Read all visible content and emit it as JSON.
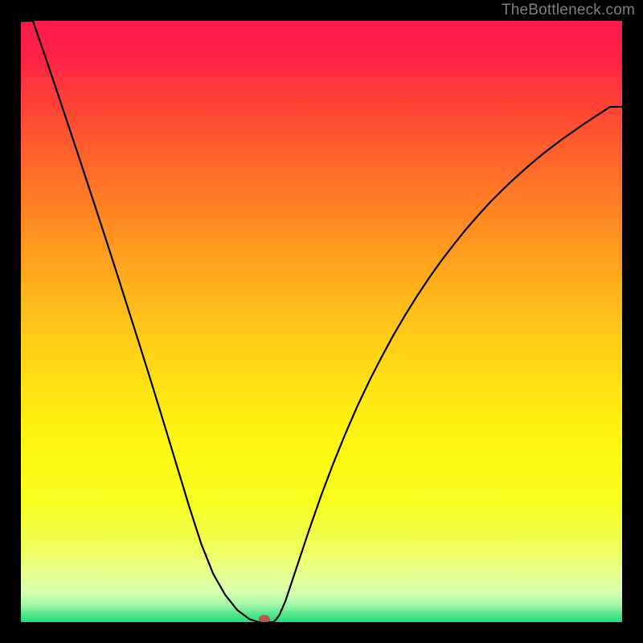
{
  "watermark": "TheBottleneck.com",
  "chart_data": {
    "type": "line",
    "x": [
      0.0,
      0.02,
      0.04,
      0.06,
      0.08,
      0.1,
      0.12,
      0.14,
      0.16,
      0.18,
      0.2,
      0.22,
      0.24,
      0.26,
      0.28,
      0.3,
      0.32,
      0.34,
      0.36,
      0.38,
      0.395,
      0.4,
      0.405,
      0.41,
      0.415,
      0.42,
      0.425,
      0.43,
      0.44,
      0.46,
      0.48,
      0.5,
      0.52,
      0.54,
      0.56,
      0.58,
      0.6,
      0.62,
      0.64,
      0.66,
      0.68,
      0.7,
      0.72,
      0.74,
      0.76,
      0.78,
      0.8,
      0.82,
      0.84,
      0.86,
      0.88,
      0.9,
      0.92,
      0.94,
      0.96,
      0.98,
      1.0
    ],
    "values": [
      1.0,
      1.0,
      0.942,
      0.883,
      0.823,
      0.763,
      0.702,
      0.641,
      0.579,
      0.516,
      0.453,
      0.389,
      0.324,
      0.258,
      0.192,
      0.13,
      0.08,
      0.045,
      0.02,
      0.005,
      0.0,
      0.0,
      0.0,
      0.0,
      0.0,
      0.0,
      0.005,
      0.012,
      0.035,
      0.095,
      0.155,
      0.212,
      0.265,
      0.314,
      0.36,
      0.402,
      0.441,
      0.478,
      0.512,
      0.544,
      0.574,
      0.602,
      0.628,
      0.653,
      0.676,
      0.698,
      0.718,
      0.737,
      0.755,
      0.772,
      0.788,
      0.803,
      0.817,
      0.831,
      0.844,
      0.857,
      0.857
    ],
    "xlabel": "",
    "ylabel": "",
    "xlim": [
      0,
      1
    ],
    "ylim": [
      0,
      1
    ],
    "curve_color": "#000000",
    "curve_stroke_width": 2.2,
    "marker": {
      "x": 0.405,
      "rx": 7,
      "ry": 5,
      "fill": "#b8574b"
    },
    "background_gradient": {
      "stops": [
        {
          "offset": 0.0,
          "color": "#ff1a4f"
        },
        {
          "offset": 0.06,
          "color": "#ff2247"
        },
        {
          "offset": 0.12,
          "color": "#ff3a3a"
        },
        {
          "offset": 0.2,
          "color": "#ff5a2e"
        },
        {
          "offset": 0.3,
          "color": "#ff7e24"
        },
        {
          "offset": 0.4,
          "color": "#ffa21e"
        },
        {
          "offset": 0.5,
          "color": "#ffc41a"
        },
        {
          "offset": 0.6,
          "color": "#ffe014"
        },
        {
          "offset": 0.7,
          "color": "#fff70e"
        },
        {
          "offset": 0.8,
          "color": "#f8ff20"
        },
        {
          "offset": 0.87,
          "color": "#f1ff55"
        },
        {
          "offset": 0.92,
          "color": "#e8ff90"
        },
        {
          "offset": 0.95,
          "color": "#d6ffb0"
        },
        {
          "offset": 0.97,
          "color": "#a8f8a8"
        },
        {
          "offset": 0.985,
          "color": "#5ee88e"
        },
        {
          "offset": 1.0,
          "color": "#1adf7c"
        }
      ]
    }
  }
}
